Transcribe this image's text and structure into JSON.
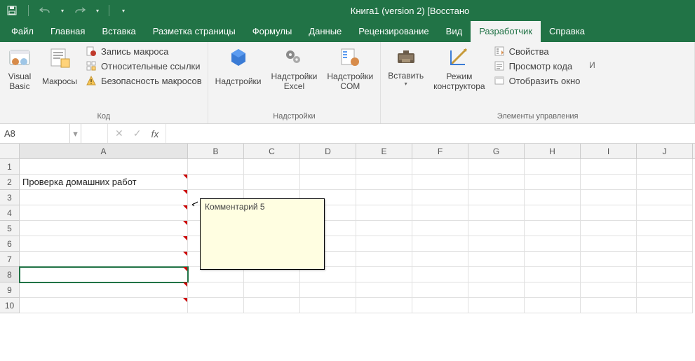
{
  "title": "Книга1 (version 2) [Восстано",
  "tabs": [
    "Файл",
    "Главная",
    "Вставка",
    "Разметка страницы",
    "Формулы",
    "Данные",
    "Рецензирование",
    "Вид",
    "Разработчик",
    "Справка"
  ],
  "active_tab_index": 8,
  "ribbon": {
    "code": {
      "vb": "Visual\nBasic",
      "macros": "Макросы",
      "record": "Запись макроса",
      "relative": "Относительные ссылки",
      "security": "Безопасность макросов",
      "label": "Код"
    },
    "addins": {
      "addinsBtn": "Надстройки",
      "excelAddins": "Надстройки\nExcel",
      "comAddins": "Надстройки\nCOM",
      "label": "Надстройки"
    },
    "controls": {
      "insert": "Вставить",
      "design": "Режим\nконструктора",
      "props": "Свойства",
      "viewcode": "Просмотр кода",
      "showwin": "Отобразить окно",
      "label": "Элементы управления"
    }
  },
  "name_box": "A8",
  "formula": "",
  "columns": [
    "A",
    "B",
    "C",
    "D",
    "E",
    "F",
    "G",
    "H",
    "I",
    "J"
  ],
  "rows_visible": 10,
  "cells": {
    "A2": "Проверка домашних работ"
  },
  "comment_rows": [
    2,
    3,
    4,
    5,
    6,
    7,
    8,
    9,
    10
  ],
  "selected_cell": "A8",
  "comment_text": "Комментарий 5"
}
